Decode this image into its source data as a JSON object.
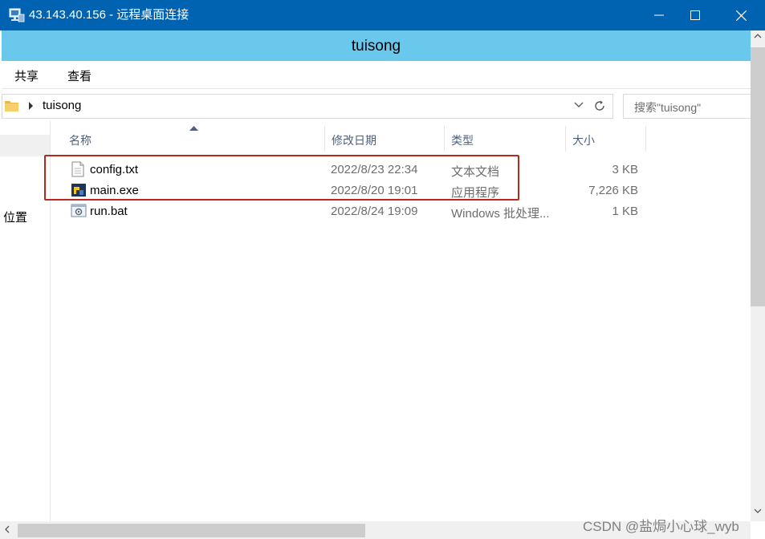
{
  "window": {
    "title": "43.143.40.156 - 远程桌面连接",
    "controls": [
      "minimize",
      "maximize",
      "close"
    ]
  },
  "explorer": {
    "title": "tuisong",
    "ribbon_tabs": [
      "共享",
      "查看"
    ],
    "address": "tuisong",
    "search_placeholder": "搜索\"tuisong\"",
    "nav_item": "位置",
    "columns": [
      "名称",
      "修改日期",
      "类型",
      "大小"
    ],
    "files": [
      {
        "name": "config.txt",
        "date": "2022/8/23 22:34",
        "type": "文本文档",
        "size": "3 KB",
        "icon": "text-file-icon"
      },
      {
        "name": "main.exe",
        "date": "2022/8/20 19:01",
        "type": "应用程序",
        "size": "7,226 KB",
        "icon": "exe-file-icon"
      },
      {
        "name": "run.bat",
        "date": "2022/8/24 19:09",
        "type": "Windows 批处理...",
        "size": "1 KB",
        "icon": "batch-file-icon"
      }
    ]
  },
  "highlight_color": "#b42a1f",
  "watermark": "CSDN @盐焗小心球_wyb"
}
